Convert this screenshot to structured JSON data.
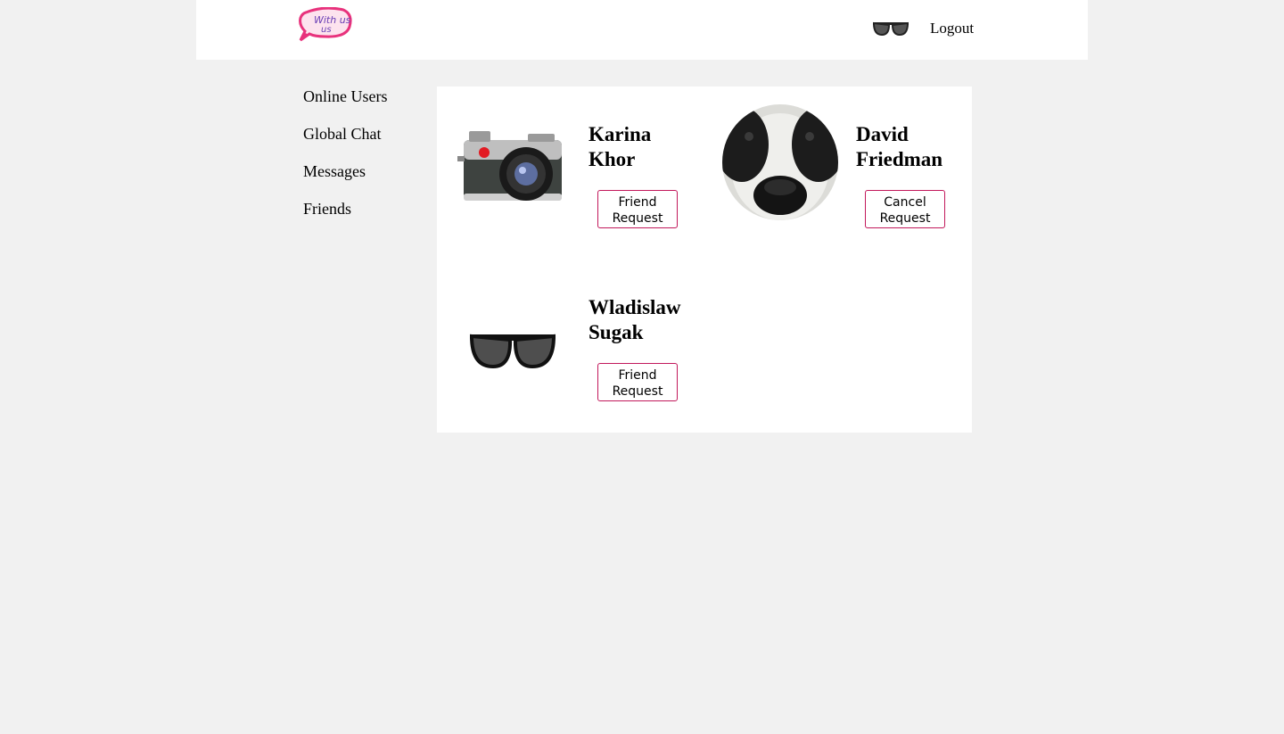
{
  "header": {
    "logo_icon": "with-us-speech-bubble-logo",
    "logo_text": "With us",
    "avatar_icon": "sunglasses-avatar",
    "logout_label": "Logout"
  },
  "sidebar": {
    "items": [
      {
        "label": "Online Users"
      },
      {
        "label": "Global Chat"
      },
      {
        "label": "Messages"
      },
      {
        "label": "Friends"
      }
    ]
  },
  "users": [
    {
      "name": "Karina Khor",
      "action_label": "Friend Request",
      "avatar_icon": "camera-avatar"
    },
    {
      "name": "David Friedman",
      "action_label": "Cancel Request",
      "avatar_icon": "panda-face-avatar"
    },
    {
      "name": "Wladislaw Sugak",
      "action_label": "Friend Request",
      "avatar_icon": "sunglasses-avatar"
    }
  ],
  "colors": {
    "page_background": "#f1f1f1",
    "panel_background": "#ffffff",
    "button_border": "#c2185b",
    "logo_pink": "#e8327c",
    "logo_purple": "#6a3fb5"
  }
}
